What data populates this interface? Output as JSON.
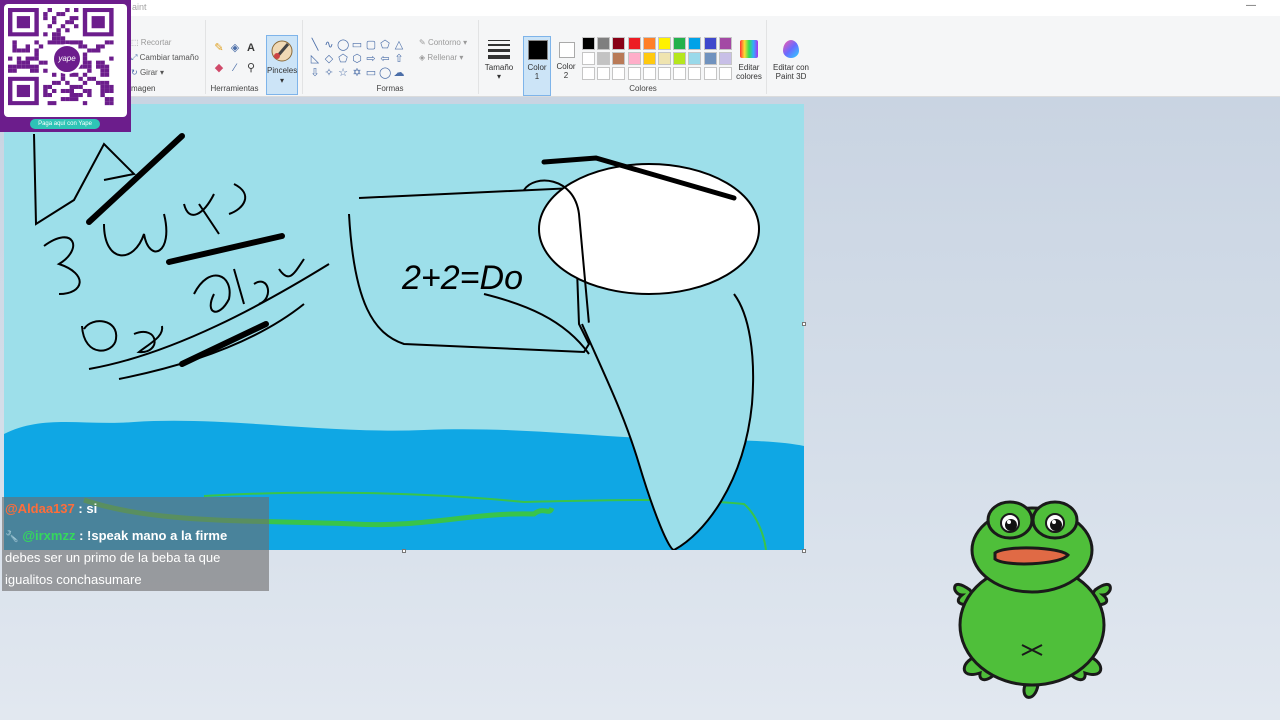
{
  "window": {
    "title": "aint"
  },
  "ribbon": {
    "image_group": {
      "label": "magen",
      "crop": "Recortar",
      "resize": "Cambiar tamaño",
      "rotate": "Girar"
    },
    "tools_group": {
      "label": "Herramientas"
    },
    "brushes": {
      "label": "Pinceles"
    },
    "shapes_group": {
      "label": "Formas",
      "outline": "Contorno",
      "fill": "Rellenar"
    },
    "size": {
      "label": "Tamaño"
    },
    "color1": {
      "label": "Color",
      "sublabel": "1"
    },
    "color2": {
      "label": "Color",
      "sublabel": "2"
    },
    "colors_group": {
      "label": "Colores"
    },
    "edit_colors": {
      "line1": "Editar",
      "line2": "colores"
    },
    "paint3d": {
      "line1": "Editar con",
      "line2": "Paint 3D"
    },
    "palette_row1": [
      "#000000",
      "#7f7f7f",
      "#880015",
      "#ed1c24",
      "#ff7f27",
      "#fff200",
      "#22b14c",
      "#00a2e8",
      "#3f48cc",
      "#a349a4"
    ],
    "palette_row2": [
      "#ffffff",
      "#c3c3c3",
      "#b97a57",
      "#ffaec9",
      "#ffc90e",
      "#efe4b0",
      "#b5e61d",
      "#99d9ea",
      "#7092be",
      "#c8bfe7"
    ]
  },
  "qr_overlay": {
    "brand": "yape",
    "pay_label": "Paga aquí con Yape"
  },
  "drawing": {
    "text_equation": "2+2=Do",
    "colors": {
      "sky": "#9ddfea",
      "sea": "#0fa7e4",
      "seaweed": "#39c44a",
      "ink": "#000000"
    }
  },
  "chat": {
    "messages": [
      {
        "user": "@Aldaa137",
        "text": " : si"
      },
      {
        "user": "@irxmzz",
        "text": " : !speak mano a la firme"
      }
    ],
    "continuation": [
      "debes ser un primo de la beba ta que",
      "igualitos conchasumare"
    ]
  }
}
